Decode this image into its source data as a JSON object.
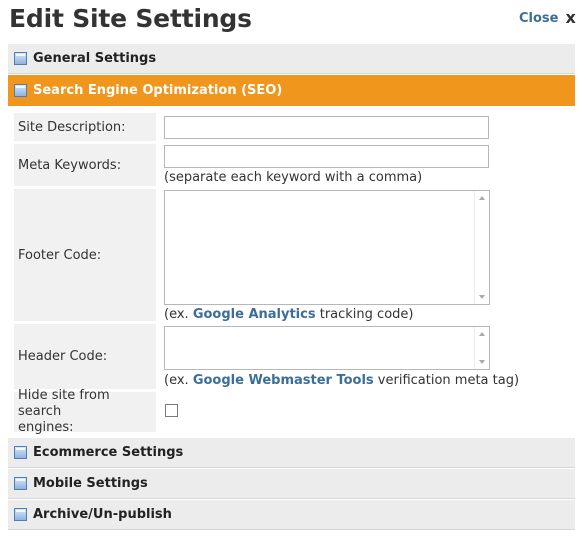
{
  "header": {
    "title": "Edit Site Settings",
    "close_label": "Close",
    "close_glyph": "x"
  },
  "sections": {
    "general": "General Settings",
    "seo": "Search Engine Optimization (SEO)",
    "ecommerce": "Ecommerce Settings",
    "mobile": "Mobile Settings",
    "archive": "Archive/Un-publish"
  },
  "fields": {
    "site_description": {
      "label": "Site Description:",
      "value": ""
    },
    "meta_keywords": {
      "label": "Meta Keywords:",
      "value": "",
      "hint": "(separate each keyword with a comma)"
    },
    "footer_code": {
      "label": "Footer Code:",
      "value": "",
      "hint_prefix": "(ex. ",
      "hint_link": "Google Analytics",
      "hint_suffix": " tracking code)"
    },
    "header_code": {
      "label": "Header Code:",
      "value": "",
      "hint_prefix": "(ex. ",
      "hint_link": "Google Webmaster Tools",
      "hint_suffix": " verification meta tag)"
    },
    "hide_search": {
      "label_line1": "Hide site from search",
      "label_line2": "engines:",
      "checked": false
    }
  },
  "colors": {
    "active_section": "#f0961c",
    "link": "#3c6e98",
    "section_bg": "#ececec",
    "label_bg": "#f1f1f1"
  }
}
